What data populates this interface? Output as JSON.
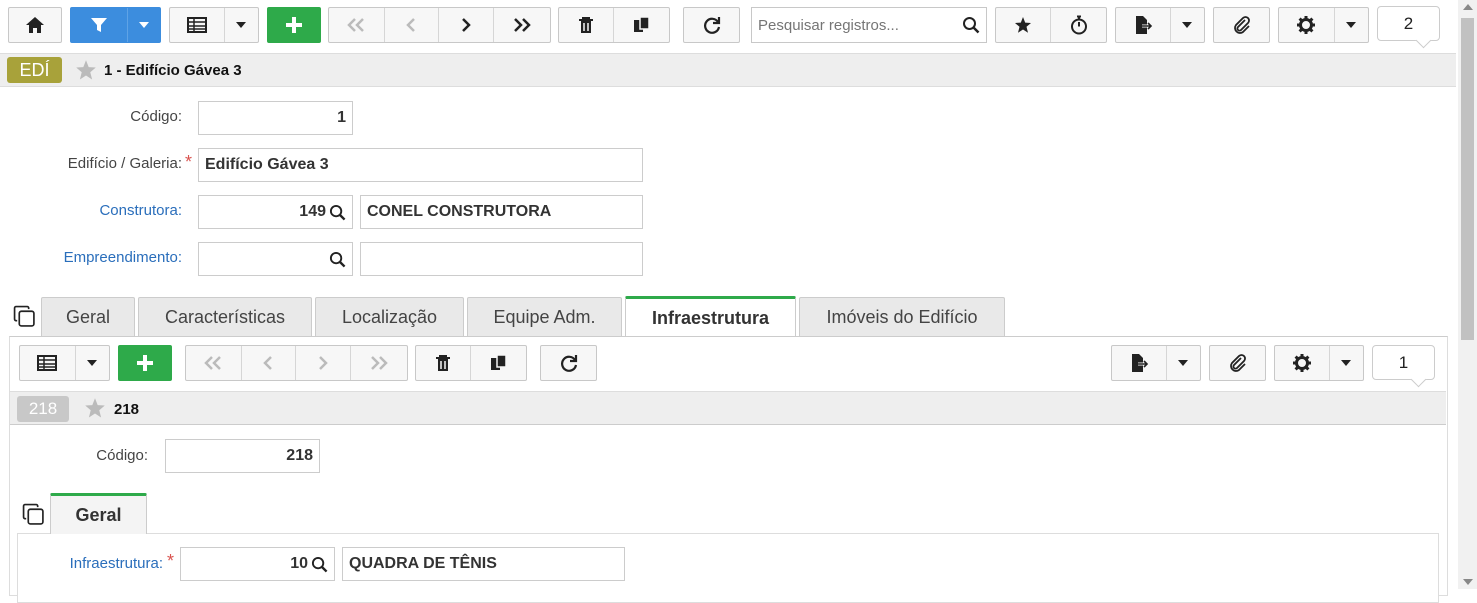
{
  "toolbar": {
    "search_placeholder": "Pesquisar registros...",
    "record_count": "2"
  },
  "record": {
    "badge": "EDÍ",
    "title": "1 - Edifício Gávea 3"
  },
  "form": {
    "codigo_label": "Código:",
    "codigo_value": "1",
    "edificio_label": "Edifício / Galeria:",
    "edificio_value": "Edifício Gávea 3",
    "construtora_label": "Construtora:",
    "construtora_code": "149",
    "construtora_name": "CONEL CONSTRUTORA",
    "empreendimento_label": "Empreendimento:",
    "empreendimento_code": "",
    "empreendimento_name": ""
  },
  "tabs": [
    {
      "label": "Geral"
    },
    {
      "label": "Características"
    },
    {
      "label": "Localização"
    },
    {
      "label": "Equipe Adm."
    },
    {
      "label": "Infraestrutura"
    },
    {
      "label": "Imóveis do Edifício"
    }
  ],
  "sub": {
    "record_count": "1",
    "badge": "218",
    "title": "218",
    "codigo_label": "Código:",
    "codigo_value": "218",
    "tab_label": "Geral",
    "infra_label": "Infraestrutura:",
    "infra_code": "10",
    "infra_name": "QUADRA DE TÊNIS"
  },
  "colors": {
    "accent_green": "#2eaa4a",
    "accent_blue": "#3c8dde",
    "badge_olive": "#a8a23a"
  }
}
